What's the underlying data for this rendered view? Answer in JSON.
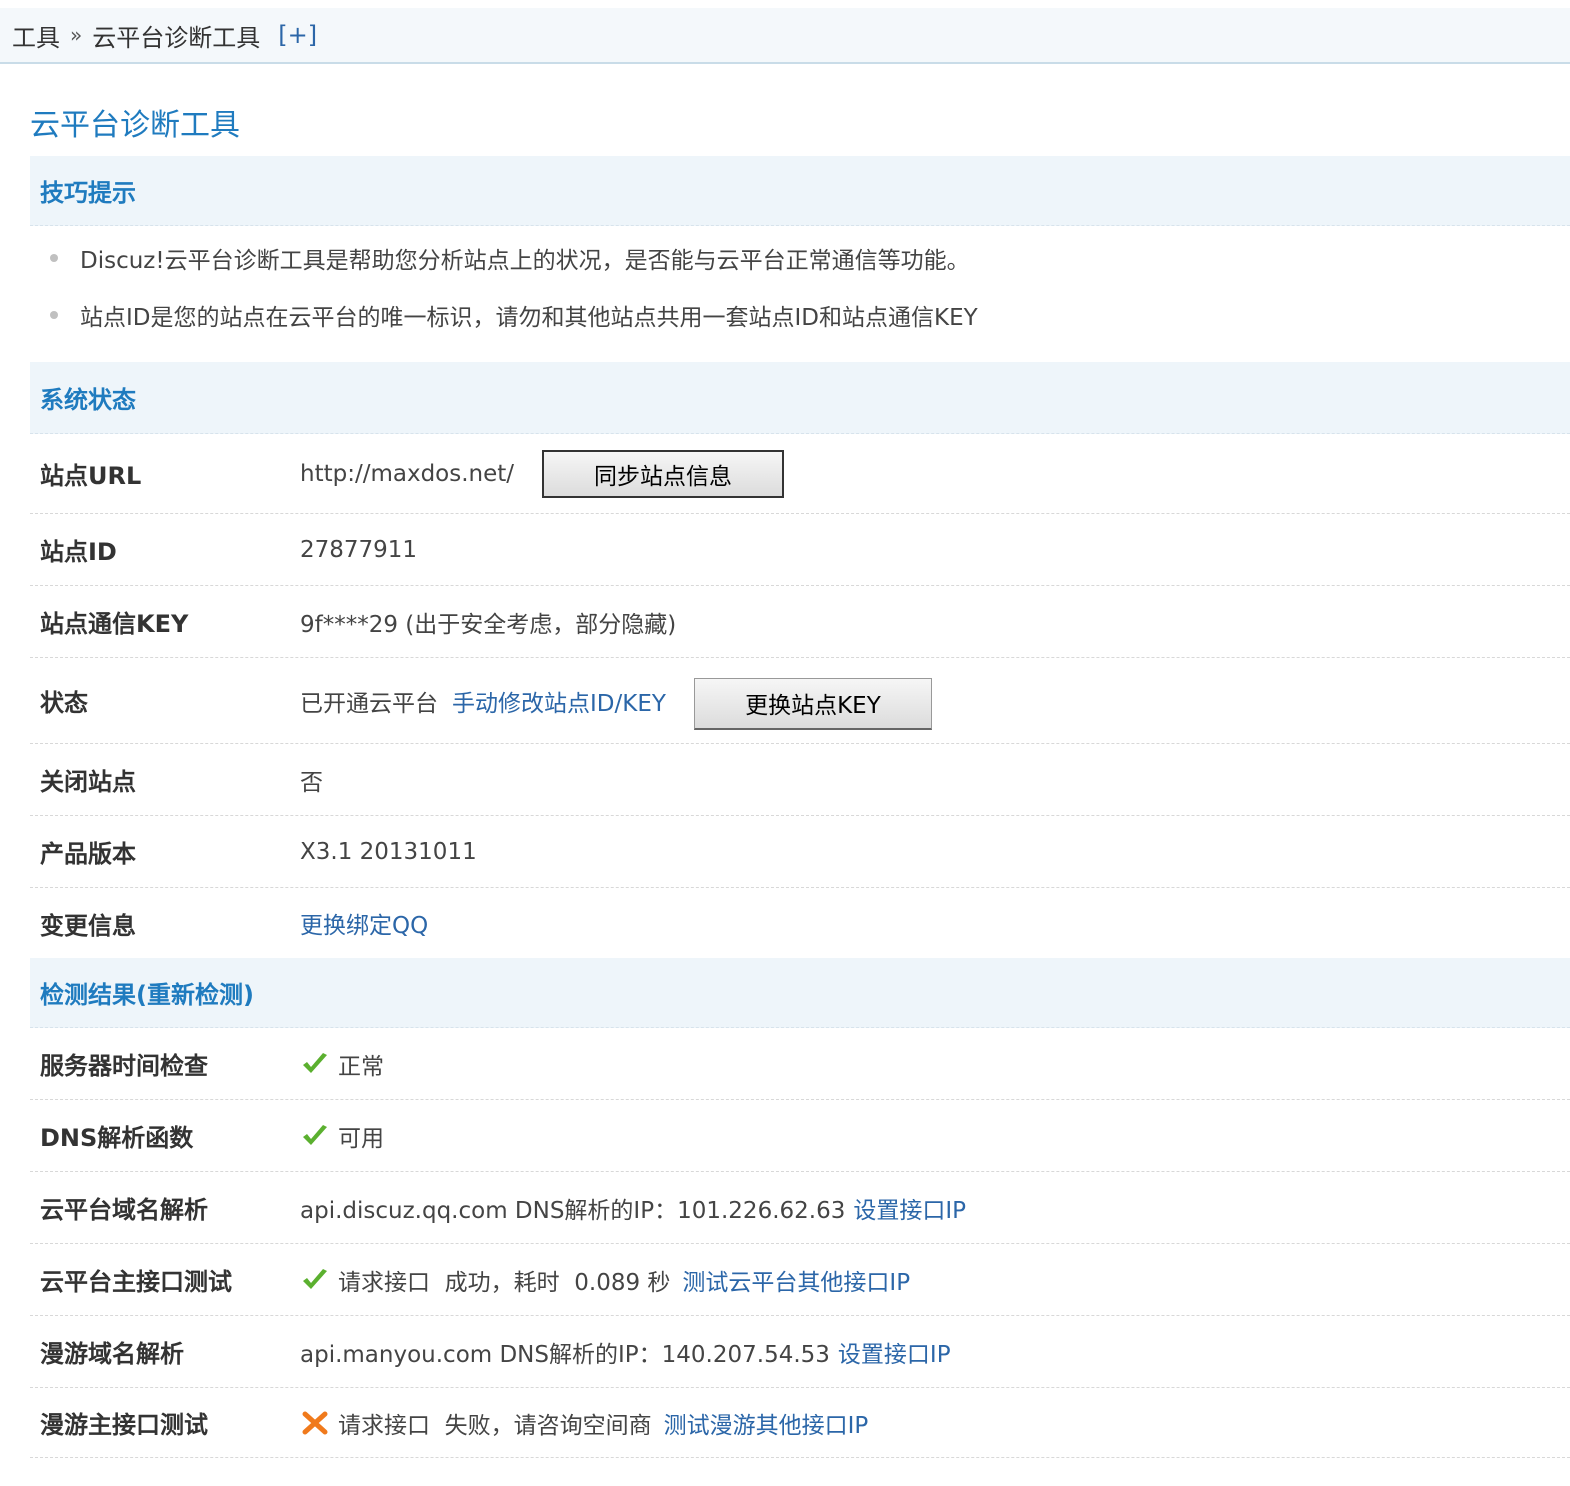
{
  "breadcrumb": {
    "root": "工具",
    "separator": "»",
    "current": "云平台诊断工具",
    "add": "[+]"
  },
  "page_title": "云平台诊断工具",
  "tips": {
    "heading": "技巧提示",
    "items": [
      "Discuz!云平台诊断工具是帮助您分析站点上的状况，是否能与云平台正常通信等功能。",
      "站点ID是您的站点在云平台的唯一标识，请勿和其他站点共用一套站点ID和站点通信KEY"
    ]
  },
  "system": {
    "heading": "系统状态",
    "site_url": {
      "label": "站点URL",
      "value": "http://maxdos.net/",
      "button": "同步站点信息"
    },
    "site_id": {
      "label": "站点ID",
      "value": "27877911"
    },
    "site_key": {
      "label": "站点通信KEY",
      "value": "9f****29 (出于安全考虑，部分隐藏)"
    },
    "status": {
      "label": "状态",
      "value": "已开通云平台",
      "link": "手动修改站点ID/KEY",
      "button": "更换站点KEY"
    },
    "close_site": {
      "label": "关闭站点",
      "value": "否"
    },
    "version": {
      "label": "产品版本",
      "value": "X3.1 20131011"
    },
    "change_info": {
      "label": "变更信息",
      "link": "更换绑定QQ"
    }
  },
  "results": {
    "heading": "检测结果(重新检测)",
    "server_time": {
      "label": "服务器时间检查",
      "value": "正常",
      "icon": "check-icon"
    },
    "dns_func": {
      "label": "DNS解析函数",
      "value": "可用",
      "icon": "check-icon"
    },
    "cloud_dns": {
      "label": "云平台域名解析",
      "value": "api.discuz.qq.com DNS解析的IP：101.226.62.63",
      "link": "设置接口IP"
    },
    "cloud_api": {
      "label": "云平台主接口测试",
      "value": "请求接口  成功，耗时  0.089 秒",
      "link": "测试云平台其他接口IP",
      "icon": "check-icon"
    },
    "manyou_dns": {
      "label": "漫游域名解析",
      "value": "api.manyou.com DNS解析的IP：140.207.54.53",
      "link": "设置接口IP"
    },
    "manyou_api": {
      "label": "漫游主接口测试",
      "value": "请求接口  失败，请咨询空间商",
      "link": "测试漫游其他接口IP",
      "icon": "cross-icon"
    }
  },
  "colors": {
    "accent": "#1f7bbf",
    "link": "#2b66a8",
    "ok": "#5bb02f",
    "fail": "#f07a1c"
  }
}
